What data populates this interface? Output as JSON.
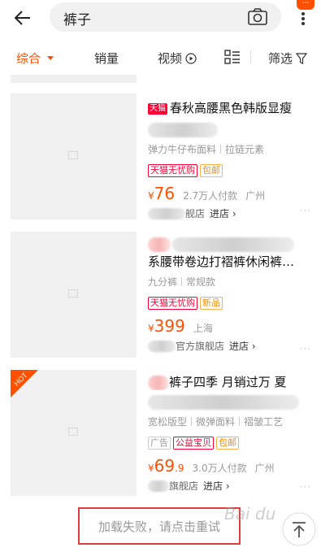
{
  "header": {
    "search_value": "裤子",
    "menu_badge": "···"
  },
  "tabs": [
    {
      "label": "综合"
    },
    {
      "label": "销量"
    },
    {
      "label": "视频"
    },
    {
      "label": "筛选"
    }
  ],
  "items": [
    {
      "tag": "天猫",
      "title": "春秋高腰黑色韩版显瘦",
      "attrs": [
        "弹力牛仔布面料",
        "拉链元素"
      ],
      "badges": [
        "天猫无忧购",
        "包邮"
      ],
      "price_symbol": "¥",
      "price": "76",
      "sales": "2.7万人付款",
      "location": "广州",
      "shop_suffix": "舰店",
      "enter": "进店"
    },
    {
      "title": "系腰带卷边打褶裤休闲裤…",
      "attrs": [
        "九分裤",
        "常规款"
      ],
      "badges": [
        "天猫无忧购",
        "新品"
      ],
      "price_symbol": "¥",
      "price": "399",
      "location": "上海",
      "shop_suffix": "官方旗舰店",
      "enter": "进店"
    },
    {
      "hot": "HOT",
      "title": "裤子四季 月销过万 夏",
      "attrs": [
        "宽松版型",
        "微弹面料",
        "褶皱工艺"
      ],
      "badges": [
        "广告",
        "公益宝贝",
        "包邮"
      ],
      "price_symbol": "¥",
      "price": "69",
      "price_decimal": ".9",
      "sales": "3.0万人付款",
      "location": "广州",
      "shop_suffix": "旗舰店",
      "enter": "进店"
    }
  ],
  "load_fail": "加载失败，请点击重试",
  "watermark": "Bai du",
  "colors": {
    "accent": "#ff5000",
    "tmall_red": "#ff0036",
    "highlight_box": "#e03c3c"
  }
}
